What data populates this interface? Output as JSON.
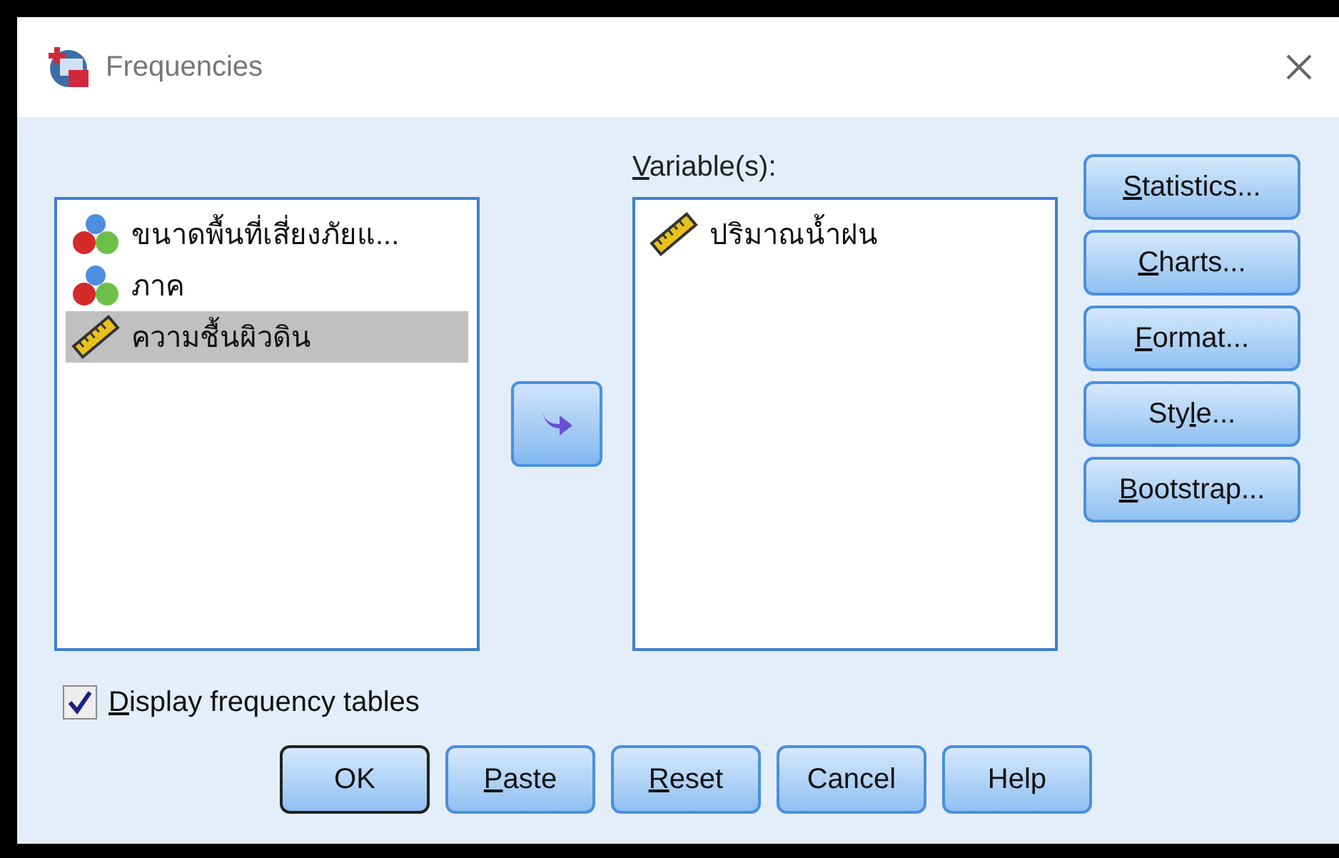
{
  "window": {
    "title": "Frequencies"
  },
  "source_list": {
    "items": [
      {
        "label": "ขนาดพื้นที่เสี่ยงภัยแ...",
        "kind": "nominal",
        "selected": false
      },
      {
        "label": "ภาค",
        "kind": "nominal",
        "selected": false
      },
      {
        "label": "ความชื้นผิวดิน",
        "kind": "scale",
        "selected": true
      }
    ]
  },
  "variables": {
    "label": [
      {
        "text": "V",
        "underlined": true
      },
      {
        "text": "ariable(s):",
        "underlined": false
      }
    ],
    "items": [
      {
        "label": "ปริมาณน้ำฝน",
        "kind": "scale",
        "selected": false
      }
    ]
  },
  "side_buttons": [
    {
      "label": [
        {
          "text": "S",
          "underlined": true
        },
        {
          "text": "tatistics...",
          "underlined": false
        }
      ]
    },
    {
      "label": [
        {
          "text": "C",
          "underlined": true
        },
        {
          "text": "harts...",
          "underlined": false
        }
      ]
    },
    {
      "label": [
        {
          "text": "F",
          "underlined": true
        },
        {
          "text": "ormat...",
          "underlined": false
        }
      ]
    },
    {
      "label": [
        {
          "text": "Sty",
          "underlined": false
        },
        {
          "text": "l",
          "underlined": true
        },
        {
          "text": "e...",
          "underlined": false
        }
      ]
    },
    {
      "label": [
        {
          "text": "B",
          "underlined": true
        },
        {
          "text": "ootstrap...",
          "underlined": false
        }
      ]
    }
  ],
  "display_frequency_tables": {
    "label": [
      {
        "text": "D",
        "underlined": true
      },
      {
        "text": "isplay frequency tables",
        "underlined": false
      }
    ],
    "checked": true
  },
  "buttons": [
    {
      "label": [
        {
          "text": "OK",
          "underlined": false
        }
      ],
      "default": true
    },
    {
      "label": [
        {
          "text": "P",
          "underlined": true
        },
        {
          "text": "aste",
          "underlined": false
        }
      ],
      "default": false
    },
    {
      "label": [
        {
          "text": "R",
          "underlined": true
        },
        {
          "text": "eset",
          "underlined": false
        }
      ],
      "default": false
    },
    {
      "label": [
        {
          "text": "Cancel",
          "underlined": false
        }
      ],
      "default": false
    },
    {
      "label": [
        {
          "text": "Help",
          "underlined": false
        }
      ],
      "default": false
    }
  ]
}
